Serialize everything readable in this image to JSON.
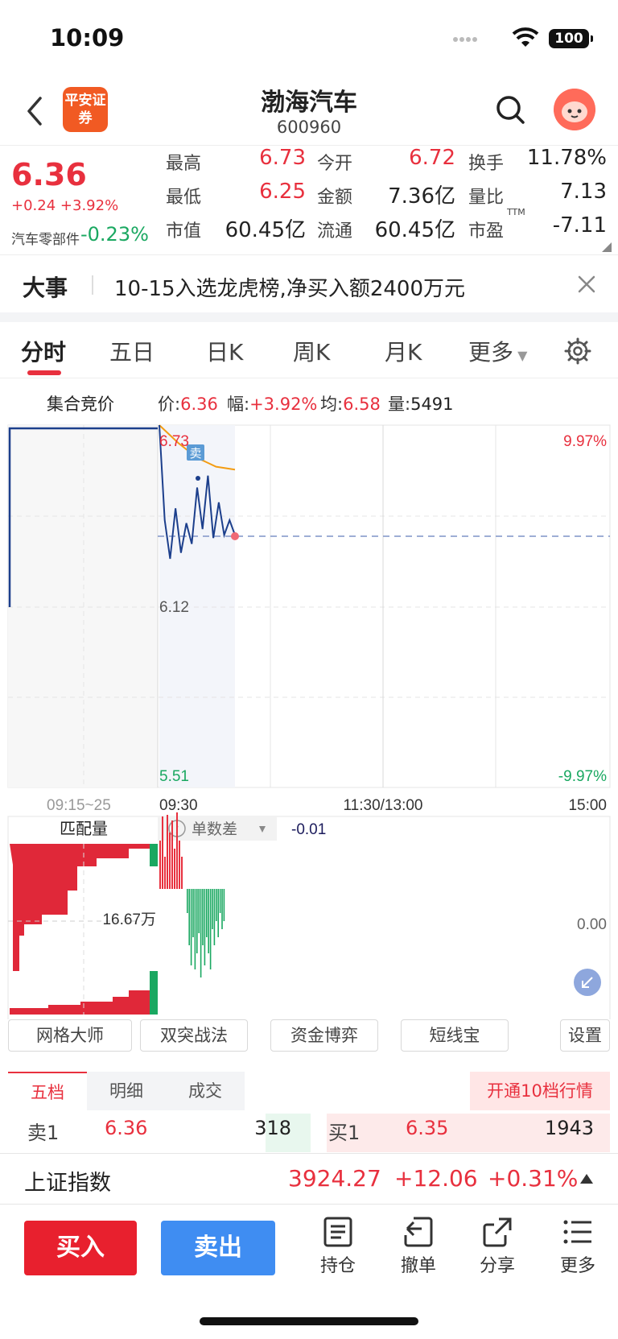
{
  "status": {
    "time": "10:09",
    "battery": "100"
  },
  "header": {
    "broker_logo": "平安证券",
    "stock_name": "渤海汽车",
    "stock_code": "600960"
  },
  "quote": {
    "price": "6.36",
    "change": "+0.24",
    "change_pct": "+3.92%",
    "sector_name": "汽车零部件",
    "sector_pct": "-0.23%",
    "fields": {
      "high_label": "最高",
      "high": "6.73",
      "low_label": "最低",
      "low": "6.25",
      "mktcap_label": "市值",
      "mktcap": "60.45亿",
      "open_label": "今开",
      "open": "6.72",
      "amount_label": "金额",
      "amount": "7.36亿",
      "float_label": "流通",
      "float": "60.45亿",
      "turnover_label": "换手",
      "turnover": "11.78%",
      "volratio_label": "量比",
      "volratio": "7.13",
      "pe_label": "市盈",
      "pe_sup": "TTM",
      "pe": "-7.11"
    }
  },
  "news": {
    "tag": "大事",
    "text": "10-15入选龙虎榜,净买入额2400万元"
  },
  "tabs": [
    "分时",
    "五日",
    "日K",
    "周K",
    "月K",
    "更多"
  ],
  "info": {
    "auction": "集合竞价",
    "price_label": "价:",
    "price": "6.36",
    "pct_label": "幅:",
    "pct": "+3.92%",
    "avg_label": "均:",
    "avg": "6.58",
    "vol_label": "量:",
    "vol": "5491"
  },
  "chart": {
    "max_label": "6.73",
    "mid_label": "6.12",
    "min_label": "5.51",
    "max_pct": "9.97%",
    "min_pct": "-9.97%",
    "sell_tag": "卖",
    "time_labels": [
      "09:15~25",
      "09:30",
      "11:30/13:00",
      "15:00"
    ],
    "match_label": "匹配量",
    "diff_label": "单数差",
    "diff_value": "-0.01",
    "match_value": "16.67万",
    "zero_value": "0.00",
    "colors": {
      "up": "#e8303e",
      "down": "#1aa861",
      "price_line": "#1c3f8c",
      "avg_line": "#f39c12"
    }
  },
  "chart_data": {
    "type": "line",
    "series": [],
    "ylim": [
      5.51,
      6.73
    ],
    "y_pct_range": [
      "-9.97%",
      "9.97%"
    ],
    "price_path": [
      {
        "x": "09:30",
        "y": 6.73
      },
      {
        "x": "09:30",
        "y": 6.41
      },
      {
        "x": "09:31",
        "y": 6.28
      },
      {
        "x": "09:32",
        "y": 6.45
      },
      {
        "x": "09:33",
        "y": 6.3
      },
      {
        "x": "09:34",
        "y": 6.4
      },
      {
        "x": "09:35",
        "y": 6.33
      },
      {
        "x": "09:36",
        "y": 6.52
      },
      {
        "x": "09:37",
        "y": 6.38
      },
      {
        "x": "09:38",
        "y": 6.56
      },
      {
        "x": "09:39",
        "y": 6.35
      },
      {
        "x": "09:40",
        "y": 6.47
      },
      {
        "x": "09:41",
        "y": 6.36
      },
      {
        "x": "09:42",
        "y": 6.41
      },
      {
        "x": "09:43",
        "y": 6.36
      }
    ],
    "avg_path": [
      {
        "x": "09:30",
        "y": 6.73
      },
      {
        "x": "09:31",
        "y": 6.67
      },
      {
        "x": "09:33",
        "y": 6.62
      },
      {
        "x": "09:36",
        "y": 6.59
      },
      {
        "x": "09:43",
        "y": 6.58
      }
    ],
    "prev_close": 6.12
  },
  "tools": [
    "网格大师",
    "双突战法",
    "资金博弈",
    "短线宝",
    "设置"
  ],
  "book": {
    "tabs": [
      "五档",
      "明细",
      "成交"
    ],
    "upgrade": "开通10档行情",
    "sell1_label": "卖1",
    "sell1_price": "6.36",
    "sell1_vol": "318",
    "buy1_label": "买1",
    "buy1_price": "6.35",
    "buy1_vol": "1943"
  },
  "index": {
    "name": "上证指数",
    "value": "3924.27",
    "change": "+12.06",
    "pct": "+0.31%"
  },
  "bottom": {
    "buy": "买入",
    "sell": "卖出",
    "items": [
      "持仓",
      "撤单",
      "分享",
      "更多"
    ]
  }
}
